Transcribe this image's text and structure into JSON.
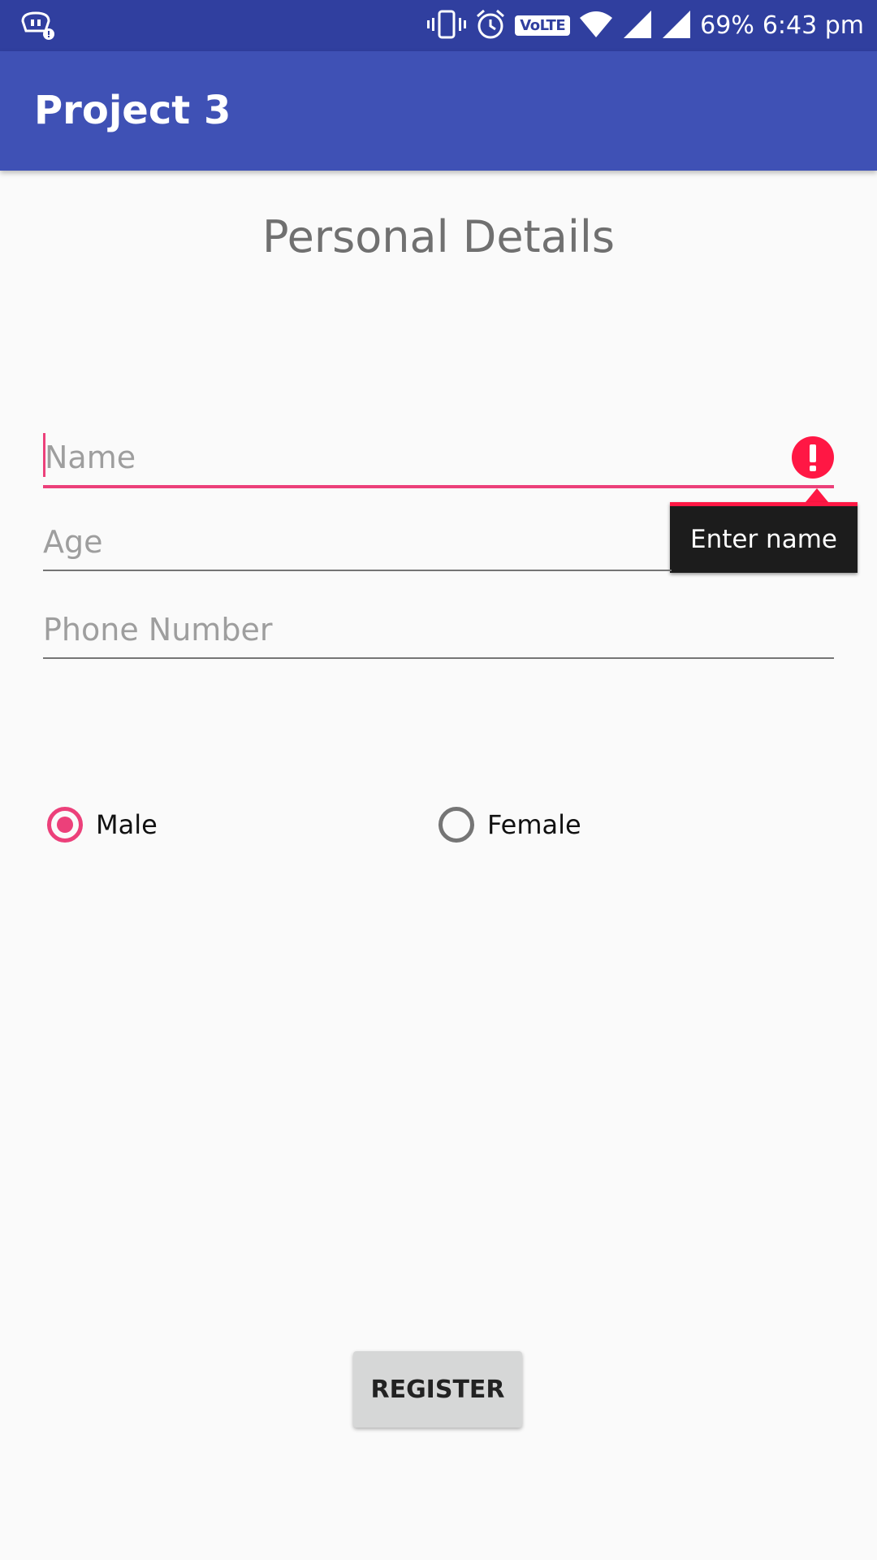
{
  "status_bar": {
    "battery": "69%",
    "time": "6:43 pm",
    "network_label": "VoLTE",
    "icons": [
      "notification-app-icon",
      "vibrate-icon",
      "alarm-icon",
      "volte-icon",
      "wifi-icon",
      "signal-icon",
      "signal-icon"
    ]
  },
  "app_bar": {
    "title": "Project 3",
    "color": "#3f51b5"
  },
  "form": {
    "heading": "Personal Details",
    "name": {
      "placeholder": "Name",
      "value": "",
      "error": "Enter name"
    },
    "age": {
      "placeholder": "Age",
      "value": ""
    },
    "phone": {
      "placeholder": "Phone Number",
      "value": ""
    },
    "gender": {
      "options": [
        {
          "label": "Male",
          "checked": true
        },
        {
          "label": "Female",
          "checked": false
        }
      ]
    },
    "register_label": "REGISTER"
  },
  "colors": {
    "accent": "#ec407a",
    "error": "#ff1744",
    "status_bar": "#303f9f"
  }
}
